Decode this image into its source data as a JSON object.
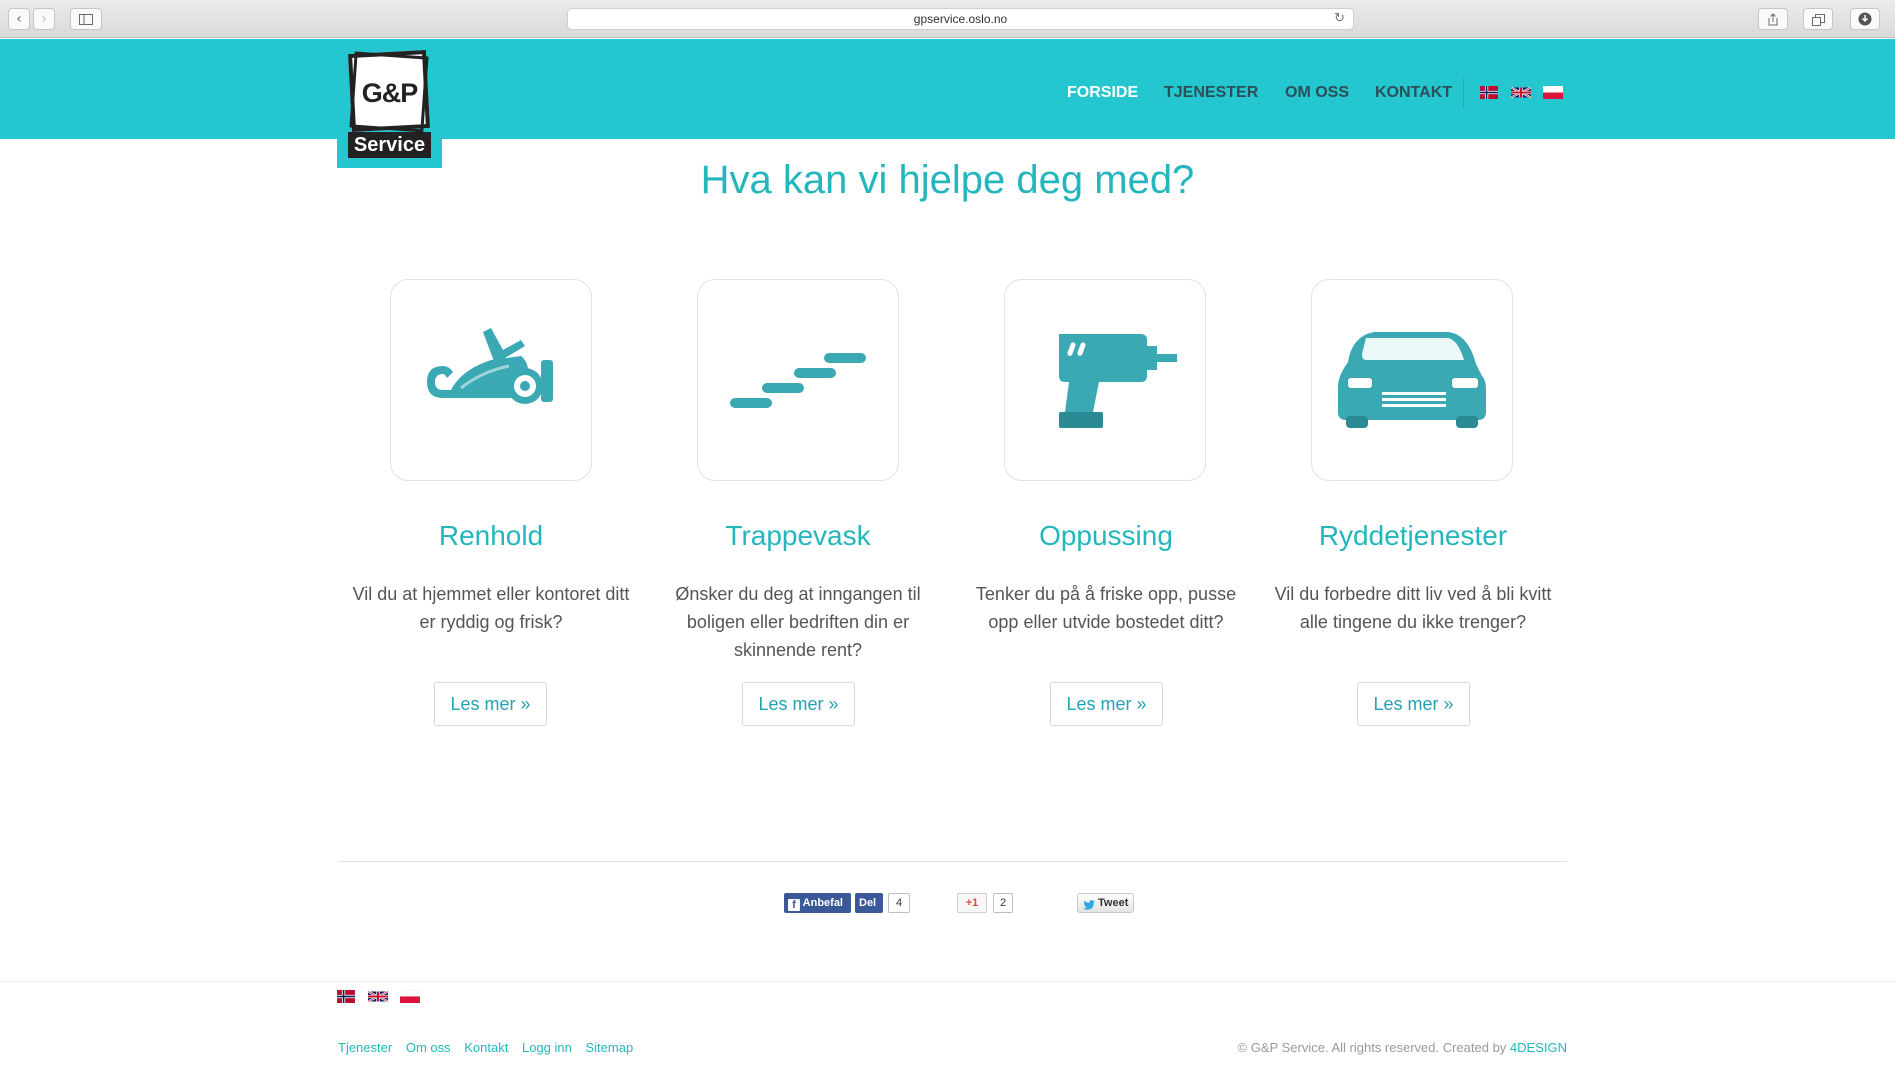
{
  "browser": {
    "url": "gpservice.oslo.no",
    "back_icon": "chevron-left",
    "forward_icon": "chevron-right",
    "sidebar_icon": "sidebar",
    "reload_icon": "reload",
    "share_icon": "share",
    "tabs_icon": "tabs",
    "download_icon": "download"
  },
  "logo": {
    "brand": "G&P",
    "sub": "Service"
  },
  "nav": {
    "items": [
      {
        "label": "FORSIDE",
        "active": true
      },
      {
        "label": "TJENESTER",
        "active": false
      },
      {
        "label": "OM OSS",
        "active": false
      },
      {
        "label": "KONTAKT",
        "active": false
      }
    ],
    "languages": [
      "norwegian-flag",
      "uk-flag",
      "polish-flag"
    ]
  },
  "main": {
    "headline": "Hva kan vi hjelpe deg med?",
    "services": [
      {
        "icon": "vacuum-cleaner-icon",
        "title": "Renhold",
        "desc_lines": [
          "Vil du at hjemmet eller kontoret ditt",
          "er ryddig og frisk?"
        ],
        "button": "Les mer »"
      },
      {
        "icon": "stairs-icon",
        "title": "Trappevask",
        "desc_lines": [
          "Ønsker du deg at inngangen til",
          "boligen eller bedriften din er",
          "skinnende rent?"
        ],
        "button": "Les mer »"
      },
      {
        "icon": "drill-icon",
        "title": "Oppussing",
        "desc_lines": [
          "Tenker du på å friske opp, pusse",
          "opp eller utvide bostedet ditt?"
        ],
        "button": "Les mer »"
      },
      {
        "icon": "van-icon",
        "title": "Ryddetjenester",
        "desc_lines": [
          "Vil du forbedre ditt liv ved å bli kvitt",
          "alle tingene du ikke trenger?"
        ],
        "button": "Les mer »"
      }
    ]
  },
  "social": {
    "fb_recommend": "Anbefal",
    "fb_share": "Del",
    "fb_count": "4",
    "gplus_label": "+1",
    "gplus_count": "2",
    "tweet_label": "Tweet"
  },
  "footer": {
    "links": [
      "Tjenester",
      "Om oss",
      "Kontakt",
      "Logg inn",
      "Sitemap"
    ],
    "copyright": "© G&P Service. All rights reserved. Created by ",
    "creator": "4DESIGN"
  },
  "colors": {
    "accent": "#24c7cf",
    "accent_text": "#23b7bd",
    "nav_text": "#2d4e57",
    "icon": "#3aa9b4"
  }
}
